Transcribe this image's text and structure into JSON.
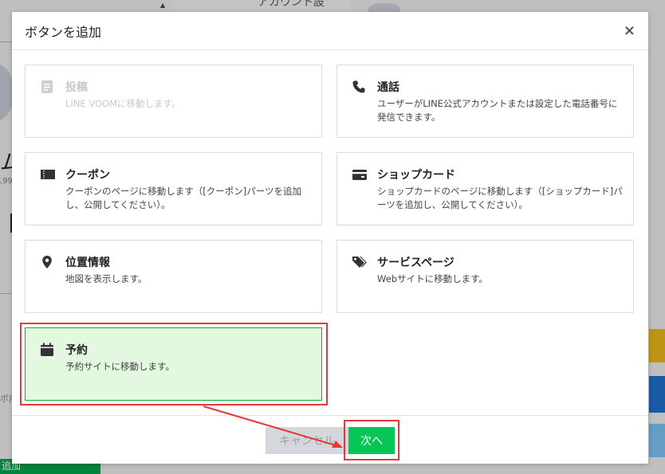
{
  "background": {
    "title": "アカウント設",
    "left_big": "ム",
    "left_small": ",99",
    "left_label": "ボ用",
    "bottom_green": "追加"
  },
  "modal": {
    "title": "ボタンを追加",
    "close": "×",
    "options": [
      {
        "title": "投稿",
        "desc": "LINE VOOMに移動します。",
        "icon": "document-icon",
        "state": "disabled"
      },
      {
        "title": "通話",
        "desc": "ユーザーがLINE公式アカウントまたは設定した電話番号に発信できます。",
        "icon": "phone-icon",
        "state": "normal"
      },
      {
        "title": "クーポン",
        "desc": "クーポンのページに移動します（[クーポン]パーツを追加し、公開してください）。",
        "icon": "coupon-icon",
        "state": "normal"
      },
      {
        "title": "ショップカード",
        "desc": "ショップカードのページに移動します（[ショップカード]パーツを追加し、公開してください）。",
        "icon": "card-icon",
        "state": "normal"
      },
      {
        "title": "位置情報",
        "desc": "地図を表示します。",
        "icon": "location-pin-icon",
        "state": "normal"
      },
      {
        "title": "サービスページ",
        "desc": "Webサイトに移動します。",
        "icon": "tag-icon",
        "state": "normal"
      },
      {
        "title": "予約",
        "desc": "予約サイトに移動します。",
        "icon": "calendar-icon",
        "state": "selected"
      }
    ],
    "cancel_label": "キャンセル",
    "next_label": "次へ"
  },
  "colors": {
    "accent_green": "#06c755",
    "selected_bg": "#e2f8df",
    "annotation_red": "#e53935"
  }
}
